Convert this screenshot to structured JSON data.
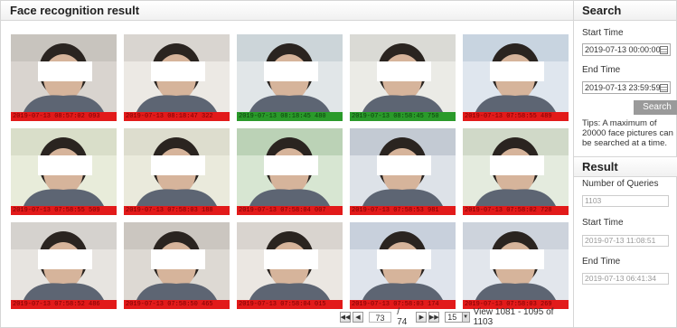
{
  "results_panel": {
    "title": "Face recognition result",
    "items": [
      {
        "timestamp": "2019-07-13 08:57:02 093",
        "status": "red"
      },
      {
        "timestamp": "2019-07-13 08:18:47 322",
        "status": "red"
      },
      {
        "timestamp": "2019-07-13 08:18:45 480",
        "status": "green"
      },
      {
        "timestamp": "2019-07-13 08:58:45 750",
        "status": "green"
      },
      {
        "timestamp": "2019-07-13 07:58:55 489",
        "status": "red"
      },
      {
        "timestamp": "2019-07-13 07:58:55 509",
        "status": "red"
      },
      {
        "timestamp": "2019-07-13 07:58:03 188",
        "status": "red"
      },
      {
        "timestamp": "2019-07-13 07:58:04 007",
        "status": "red"
      },
      {
        "timestamp": "2019-07-13 07:58:53 981",
        "status": "red"
      },
      {
        "timestamp": "2019-07-13 07:58:02 728",
        "status": "red"
      },
      {
        "timestamp": "2019-07-13 07:58:52 486",
        "status": "red"
      },
      {
        "timestamp": "2019-07-13 07:58:50 465",
        "status": "red"
      },
      {
        "timestamp": "2019-07-13 07:58:04 015",
        "status": "red"
      },
      {
        "timestamp": "2019-07-13 07:58:03 174",
        "status": "red"
      },
      {
        "timestamp": "2019-07-13 07:58:03 269",
        "status": "red"
      }
    ]
  },
  "pagination": {
    "first_icon": "first-page-icon",
    "prev_icon": "prev-page-icon",
    "current_page": "73",
    "total_pages": "/ 74",
    "next_icon": "next-page-icon",
    "last_icon": "last-page-icon",
    "page_size": "15",
    "view_text": "View 1081 - 1095 of 1103"
  },
  "search": {
    "title": "Search",
    "start_time_label": "Start Time",
    "start_time_value": "2019-07-13 00:00:00",
    "end_time_label": "End Time",
    "end_time_value": "2019-07-13 23:59:59",
    "button_label": "Search",
    "tips": "Tips: A maximum of 20000 face pictures can be searched at a time."
  },
  "result": {
    "title": "Result",
    "queries_label": "Number of Queries",
    "queries_value": "1103",
    "start_time_label": "Start Time",
    "start_time_value": "2019-07-13  11:08:51",
    "end_time_label": "End Time",
    "end_time_value": "2019-07-13  06:41:34"
  },
  "colors": {
    "stamp_red": "#e21a1a",
    "stamp_green": "#2a9a2a",
    "button_gray": "#9a9a9a"
  }
}
